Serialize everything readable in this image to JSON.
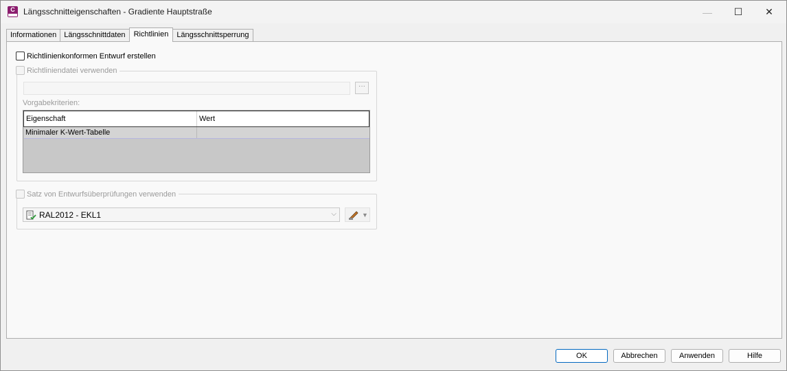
{
  "window": {
    "title": "Längsschnitteigenschaften - Gradiente Hauptstraße",
    "app_icon_letter": "C"
  },
  "title_buttons": {
    "minimize": "—",
    "maximize": "☐",
    "close": "✕"
  },
  "tabs": [
    {
      "label": "Informationen",
      "active": false
    },
    {
      "label": "Längsschnittdaten",
      "active": false
    },
    {
      "label": "Richtlinien",
      "active": true
    },
    {
      "label": "Längsschnittsperrung",
      "active": false
    }
  ],
  "panel": {
    "design_checkbox_label": "Richtlinienkonformen Entwurf erstellen",
    "design_checkbox_checked": false,
    "criteria_file_checkbox_label": "Richtliniendatei verwenden",
    "criteria_file_value": "",
    "browse_label": "···",
    "grid_label": "Vorgabekriterien:",
    "grid": {
      "columns": [
        "Eigenschaft",
        "Wert"
      ],
      "rows": [
        {
          "property": "Minimaler K-Wert-Tabelle",
          "value": ""
        }
      ]
    },
    "check_set_checkbox_label": "Satz von Entwurfsüberprüfungen verwenden",
    "check_set_value": "RAL2012 - EKL1"
  },
  "buttons": {
    "ok": "OK",
    "cancel": "Abbrechen",
    "apply": "Anwenden",
    "help": "Hilfe"
  },
  "colors": {
    "accent": "#0067c0",
    "app_icon": "#8b1d6e",
    "grid_empty": "#c8c8c8"
  }
}
